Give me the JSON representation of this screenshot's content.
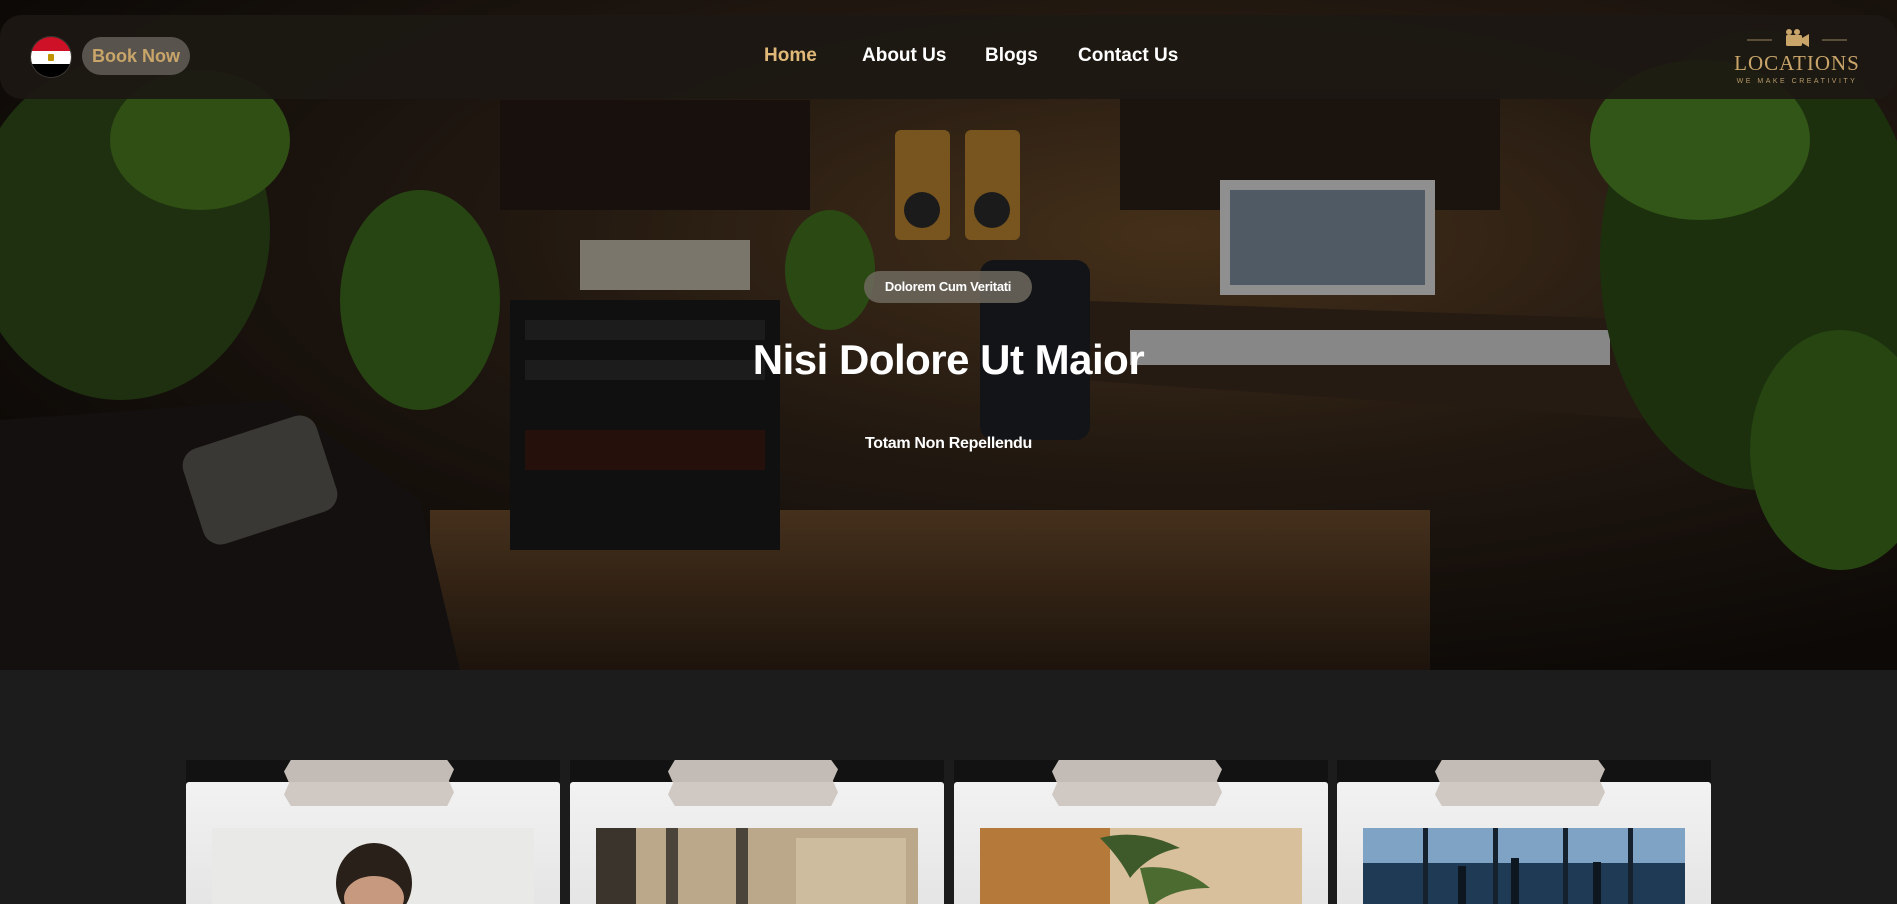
{
  "nav": {
    "flag_icon": "egypt-flag-icon",
    "book_label": "Book Now",
    "links": [
      {
        "label": "Home",
        "active": true
      },
      {
        "label": "About Us",
        "active": false
      },
      {
        "label": "Blogs",
        "active": false
      },
      {
        "label": "Contact Us",
        "active": false
      }
    ],
    "brand": {
      "icon": "camera-icon",
      "name": "LOCATIONS",
      "tagline": "WE MAKE CREATIVITY"
    }
  },
  "hero": {
    "badge": "Dolorem Cum Veritati",
    "title": "Nisi Dolore Ut Maior",
    "subtitle": "Totam Non Repellendu"
  },
  "colors": {
    "accent": "#c9a56a",
    "active_link": "#e0b878",
    "page_bg": "#1c1c1c"
  }
}
